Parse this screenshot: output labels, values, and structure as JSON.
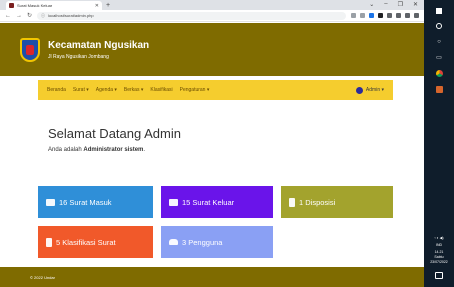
{
  "browser": {
    "tab_title": "Surat Masuk Keluar",
    "new_tab": "+",
    "url": "localhost/surat/admin.php",
    "window_controls": [
      "⌄",
      "–",
      "❐",
      "✕"
    ]
  },
  "header": {
    "title": "Kecamatan Ngusikan",
    "subtitle": "Jl Raya Ngusikan Jombang"
  },
  "nav": {
    "items": [
      "Beranda",
      "Surat ▾",
      "Agenda ▾",
      "Berkas ▾",
      "Klasifikasi",
      "Pengaturan ▾"
    ],
    "user": "Admin ▾"
  },
  "jumbotron": {
    "heading": "Selamat Datang Admin",
    "text_prefix": "Anda adalah ",
    "text_bold": "Administrator sistem",
    "text_suffix": "."
  },
  "cards": [
    {
      "label": "16 Surat Masuk",
      "icon": "envelope-icon",
      "color": "#2f8fd8"
    },
    {
      "label": "15 Surat Keluar",
      "icon": "envelope-open-icon",
      "color": "#6a14ea"
    },
    {
      "label": "1 Disposisi",
      "icon": "document-icon",
      "color": "#a3a32d"
    },
    {
      "label": "5 Klasifikasi Surat",
      "icon": "book-icon",
      "color": "#f1592a"
    },
    {
      "label": "3 Pengguna",
      "icon": "users-icon",
      "color": "#8aa0f4"
    }
  ],
  "footer": {
    "text": "© 2022 Undar"
  },
  "taskbar": {
    "time": "14.21",
    "day": "Sabtu",
    "date": "23/07/2022",
    "lang": "IND"
  },
  "colors": {
    "header_bg": "#7f6b00",
    "navbar_bg": "#f5cd2e",
    "taskbar_bg": "#0f1d2b"
  }
}
